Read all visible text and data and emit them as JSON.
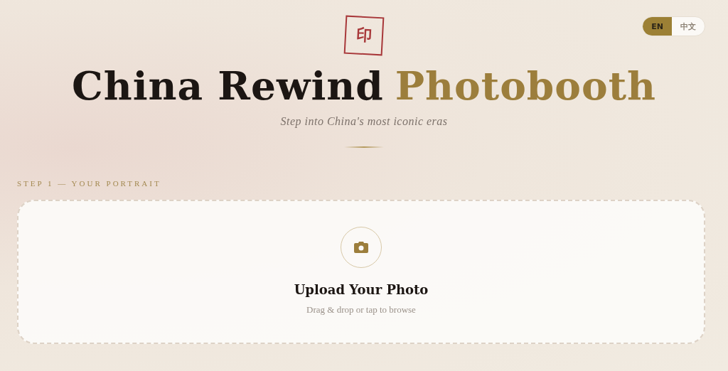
{
  "stamp": {
    "glyph": "印"
  },
  "language_toggle": [
    {
      "label": "EN",
      "selected": true
    },
    {
      "label": "中文",
      "selected": false
    }
  ],
  "title": [
    {
      "text": "China Rewind",
      "kind": "plain"
    },
    {
      "text": "Photobooth",
      "kind": "accent"
    }
  ],
  "subtitle": "Step into China's most iconic eras",
  "step_label": "STEP 1 — YOUR PORTRAIT",
  "upload": {
    "heading": "Upload Your Photo",
    "hint": "Drag & drop or tap to browse"
  }
}
